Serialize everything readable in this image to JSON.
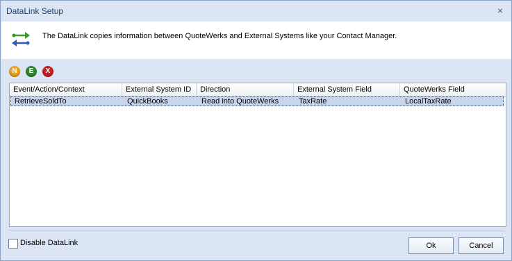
{
  "window": {
    "title": "DataLink Setup",
    "close_glyph": "×"
  },
  "header": {
    "icon": "datalink-arrows-icon",
    "text": "The DataLink copies information between QuoteWerks and External Systems like your Contact Manager."
  },
  "toolbar": {
    "buttons": [
      {
        "label": "N",
        "name": "new",
        "color": "#e8a21c"
      },
      {
        "label": "E",
        "name": "edit",
        "color": "#2b8a2b"
      },
      {
        "label": "X",
        "name": "delete",
        "color": "#c8201e"
      }
    ]
  },
  "grid": {
    "columns": [
      "Event/Action/Context",
      "External System ID",
      "Direction",
      "External System Field",
      "QuoteWerks Field"
    ],
    "rows": [
      [
        "RetrieveSoldTo",
        "QuickBooks",
        "Read into QuoteWerks",
        "TaxRate",
        "LocalTaxRate"
      ]
    ]
  },
  "footer": {
    "disable_label": "Disable DataLink",
    "disable_checked": false,
    "ok_label": "Ok",
    "cancel_label": "Cancel"
  }
}
